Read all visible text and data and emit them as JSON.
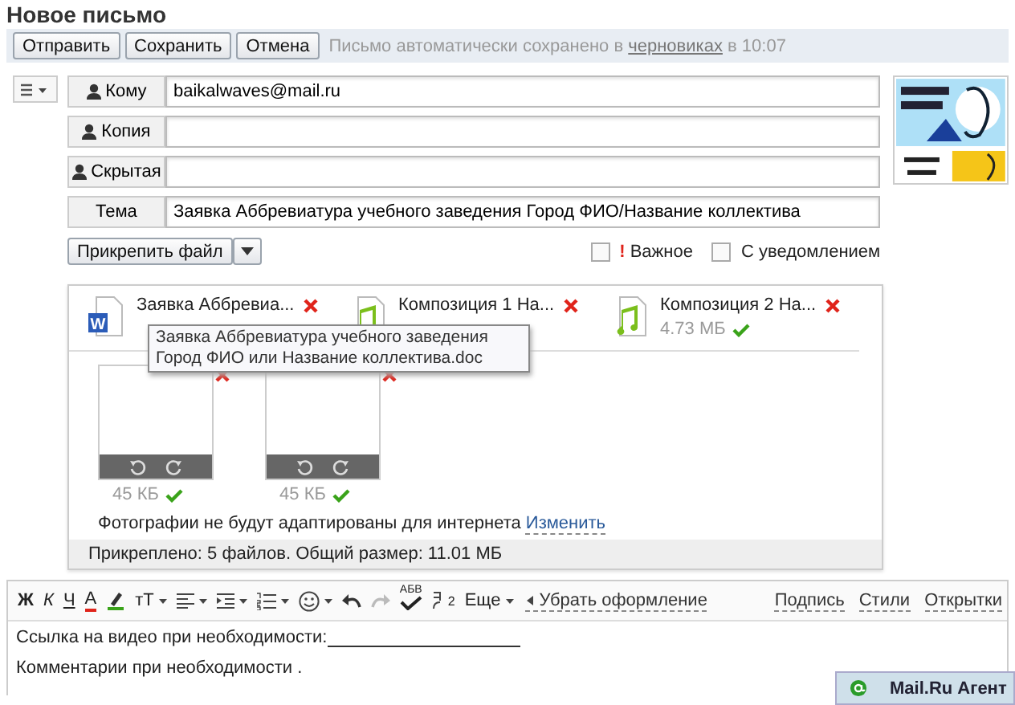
{
  "title": "Новое письмо",
  "toolbar": {
    "buttons": [
      "Отправить",
      "Сохранить",
      "Отмена"
    ],
    "autosave": {
      "before": "Письмо автоматически сохранено в ",
      "link": "черновиках",
      "after": " в 10:07"
    }
  },
  "fields": [
    {
      "label": "Кому",
      "person": true,
      "value": "baikalwaves@mail.ru"
    },
    {
      "label": "Копия",
      "person": true
    },
    {
      "label": "Скрытая",
      "person": true
    },
    {
      "label": "Тема",
      "person": false,
      "value": "Заявка Аббревиатура учебного заведения Город ФИО/Название коллектива"
    }
  ],
  "avatar": {
    "kind": "picture"
  },
  "attach_button": "Прикрепить файл",
  "options": [
    {
      "label": "Важное",
      "mark": "!",
      "checked": false
    },
    {
      "label": "С уведомлением",
      "checked": false
    }
  ],
  "files": [
    {
      "kind": "doc",
      "icon_label": "W",
      "name": "Заявка Аббревиа..."
    },
    {
      "kind": "audio",
      "name": "Композиция 1 На..."
    },
    {
      "kind": "audio",
      "name": "Композиция 2 На...",
      "size": "4.73 МБ"
    }
  ],
  "tooltip": "Заявка Аббревиатура учебного заведения Город ФИО или Название коллектива.doc",
  "photos": [
    {
      "size": "45 КБ"
    },
    {
      "size": "45 КБ"
    }
  ],
  "photo_note": {
    "text": "Фотографии не будут адаптированы для интернета ",
    "link": "Изменить"
  },
  "attach_summary": "Прикреплено: 5 файлов. Общий размер: 11.01 МБ",
  "format_tools": [
    {
      "kind": "bold",
      "label": "Ж"
    },
    {
      "kind": "italic",
      "label": "К"
    },
    {
      "kind": "underline",
      "label": "Ч"
    },
    {
      "kind": "color",
      "label": "А"
    },
    {
      "kind": "marker"
    },
    {
      "kind": "size",
      "label": "тТ"
    },
    {
      "kind": "align"
    },
    {
      "kind": "indent"
    },
    {
      "kind": "list"
    },
    {
      "kind": "smiley"
    },
    {
      "kind": "undo",
      "disabled": false
    },
    {
      "kind": "redo",
      "disabled": true
    },
    {
      "kind": "spell",
      "label": "АБВ"
    },
    {
      "kind": "translit",
      "label": "2"
    },
    {
      "kind": "more",
      "label": "Еще"
    }
  ],
  "clear_format": "Убрать оформление",
  "right_links": [
    "Подпись",
    "Стили",
    "Открытки"
  ],
  "body": [
    {
      "text": "Ссылка на видео при необходимости: ",
      "blank": true
    },
    {
      "text": "Комментарии при необходимости ."
    }
  ],
  "agent": "Mail.Ru Агент"
}
